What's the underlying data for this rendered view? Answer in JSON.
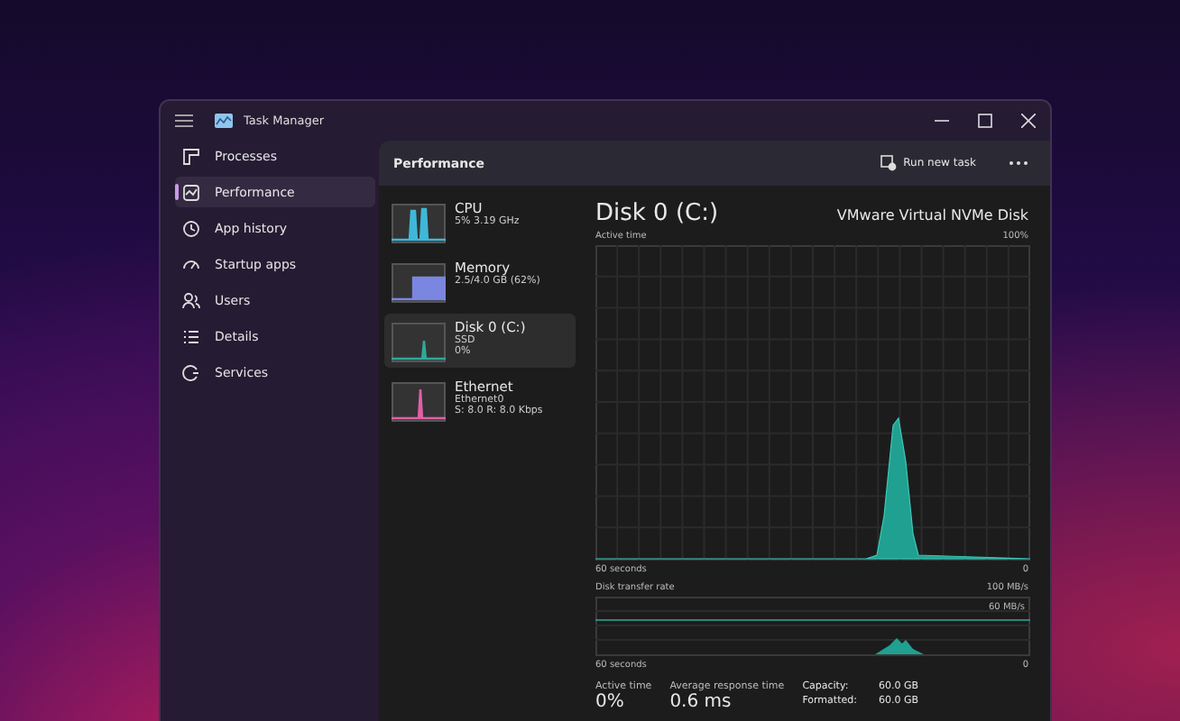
{
  "window": {
    "title": "Task Manager"
  },
  "sidebar": {
    "items": [
      {
        "label": "Processes",
        "selected": false
      },
      {
        "label": "Performance",
        "selected": true
      },
      {
        "label": "App history",
        "selected": false
      },
      {
        "label": "Startup apps",
        "selected": false
      },
      {
        "label": "Users",
        "selected": false
      },
      {
        "label": "Details",
        "selected": false
      },
      {
        "label": "Services",
        "selected": false
      }
    ]
  },
  "header": {
    "title": "Performance",
    "run_new_task": "Run new task"
  },
  "devices": [
    {
      "kind": "spikes",
      "name": "CPU",
      "lines": [
        "5% 3.19 GHz"
      ],
      "selected": false,
      "color": "#3fb8d8"
    },
    {
      "kind": "block",
      "name": "Memory",
      "lines": [
        "2.5/4.0 GB (62%)"
      ],
      "selected": false,
      "color": "#7b86e0"
    },
    {
      "kind": "peak",
      "name": "Disk 0 (C:)",
      "lines": [
        "SSD",
        "0%"
      ],
      "selected": true,
      "color": "#2fa89a"
    },
    {
      "kind": "spike",
      "name": "Ethernet",
      "lines": [
        "Ethernet0",
        "S: 8.0  R: 8.0 Kbps"
      ],
      "selected": false,
      "color": "#e060a8"
    }
  ],
  "detail": {
    "title": "Disk 0 (C:)",
    "model": "VMware Virtual NVMe Disk",
    "active_chart": {
      "label": "Active time",
      "max_label": "100%",
      "time_label": "60 seconds",
      "min_label": "0"
    },
    "transfer_chart": {
      "label": "Disk transfer rate",
      "max_label": "100 MB/s",
      "mark_label": "60 MB/s",
      "time_label": "60 seconds",
      "min_label": "0"
    },
    "stats": [
      {
        "label": "Active time",
        "value": "0%"
      },
      {
        "label": "Average response time",
        "value": "0.6 ms"
      }
    ],
    "properties": [
      {
        "label": "Capacity:",
        "value": "60.0 GB"
      },
      {
        "label": "Formatted:",
        "value": "60.0 GB"
      }
    ]
  }
}
